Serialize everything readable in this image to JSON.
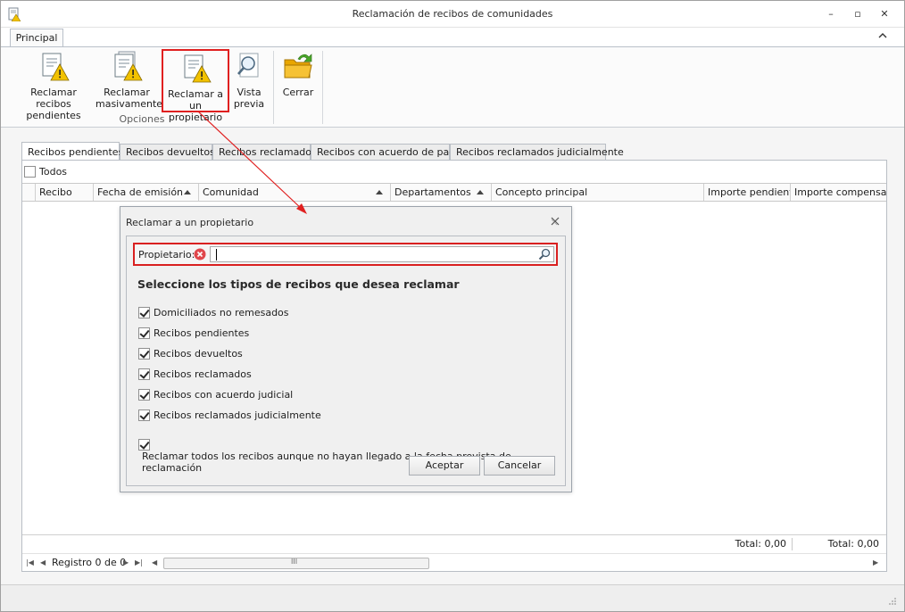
{
  "window": {
    "title": "Reclamación de recibos  de comunidades",
    "minimize": "–",
    "restore": "▫",
    "close": "✕"
  },
  "ribbon": {
    "tab": "Principal",
    "buttons": [
      {
        "label": "Reclamar recibos pendientes",
        "line1": "Reclamar recibos",
        "line2": "pendientes",
        "icon": "document-warning-icon"
      },
      {
        "label": "Reclamar masivamente",
        "line1": "Reclamar",
        "line2": "masivamente",
        "icon": "documents-warning-icon"
      },
      {
        "label": "Reclamar a un propietario",
        "line1": "Reclamar a un",
        "line2": "propietario",
        "icon": "document-warning-icon"
      },
      {
        "label": "Vista previa",
        "line1": "Vista",
        "line2": "previa",
        "icon": "magnifier-document-icon"
      },
      {
        "label": "Cerrar",
        "line1": "Cerrar",
        "line2": "",
        "icon": "folder-exit-icon"
      }
    ],
    "group_label": "Opciones"
  },
  "tabs": [
    {
      "label": "Recibos pendientes",
      "active": true
    },
    {
      "label": "Recibos devueltos",
      "active": false
    },
    {
      "label": "Recibos reclamados",
      "active": false
    },
    {
      "label": "Recibos con acuerdo de pago",
      "active": false
    },
    {
      "label": "Recibos reclamados judicialmente",
      "active": false
    }
  ],
  "grid": {
    "select_all": {
      "label": "Todos",
      "checked": false
    },
    "columns": [
      "Recibo",
      "Fecha de emisión",
      "Comunidad",
      "Departamentos",
      "Concepto principal",
      "Importe pendiente",
      "Importe compensado"
    ],
    "totals": [
      "Total: 0,00",
      "Total: 0,00"
    ],
    "record_text": "Registro 0 de 0",
    "scroll_grip": "III"
  },
  "dialog": {
    "title": "Reclamar a un propietario",
    "field_label": "Propietario:",
    "field_value": "",
    "heading": "Seleccione los tipos de recibos que desea reclamar",
    "options": [
      {
        "label": "Domiciliados no remesados",
        "checked": true
      },
      {
        "label": "Recibos pendientes",
        "checked": true
      },
      {
        "label": "Recibos devueltos",
        "checked": true
      },
      {
        "label": "Recibos reclamados",
        "checked": true
      },
      {
        "label": "Recibos con acuerdo judicial",
        "checked": true
      },
      {
        "label": "Recibos reclamados judicialmente",
        "checked": true
      }
    ],
    "extra_option": {
      "label": "Reclamar todos los recibos aunque no hayan llegado a la fecha prevista de reclamación",
      "checked": true
    },
    "accept": "Aceptar",
    "cancel": "Cancelar"
  },
  "colors": {
    "highlight": "#e02020",
    "warning": "#f2c200",
    "folder": "#f4b400",
    "error": "#e0474c"
  }
}
